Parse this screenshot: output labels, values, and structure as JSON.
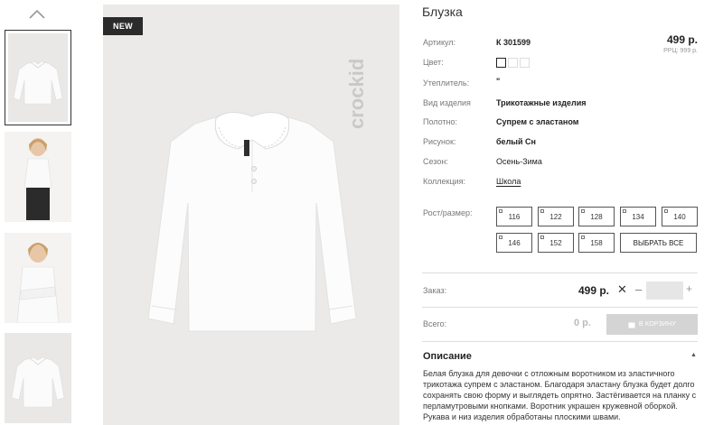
{
  "badge": "NEW",
  "brand": "crockid",
  "product": {
    "title": "Блузка",
    "price": "499 р.",
    "rrp": "РРЦ: 999 р."
  },
  "props": {
    "article_label": "Артикул:",
    "article_value": "К 301599",
    "color_label": "Цвет:",
    "insulation_label": "Утеплитель:",
    "insulation_value": "\"",
    "type_label": "Вид изделия",
    "type_value": "Трикотажные изделия",
    "fabric_label": "Полотно:",
    "fabric_value": "Супрем с эластаном",
    "pattern_label": "Рисунок:",
    "pattern_value": "белый Сн",
    "season_label": "Сезон:",
    "season_value": "Осень-Зима",
    "collection_label": "Коллекция:",
    "collection_value": "Школа"
  },
  "sizes": {
    "label": "Рост/размер:",
    "options": [
      "116",
      "122",
      "128",
      "134",
      "140",
      "146",
      "152",
      "158"
    ],
    "select_all": "ВЫБРАТЬ ВСЕ"
  },
  "order": {
    "label": "Заказ:",
    "price": "499 р.",
    "times": "✕",
    "minus": "–",
    "plus": "+",
    "qty_value": ""
  },
  "total": {
    "label": "Всего:",
    "price": "0 р.",
    "cart_button": "В КОРЗИНУ"
  },
  "description": {
    "title": "Описание",
    "caret": "▲",
    "text": "Белая блузка для девочки с отложным воротником из эластичного трикотажа супрем с эластаном. Благодаря эластану блузка будет долго сохранять свою форму и выглядеть опрятно. Застёгивается на планку с перламутровыми кнопками. Воротник украшен кружевной оборкой. Рукава и низ изделия обработаны плоскими швами."
  },
  "colors": {
    "badge_bg": "#2b2b2b",
    "image_bg": "#ebeae8",
    "cart_disabled": "#d4d4d4"
  }
}
